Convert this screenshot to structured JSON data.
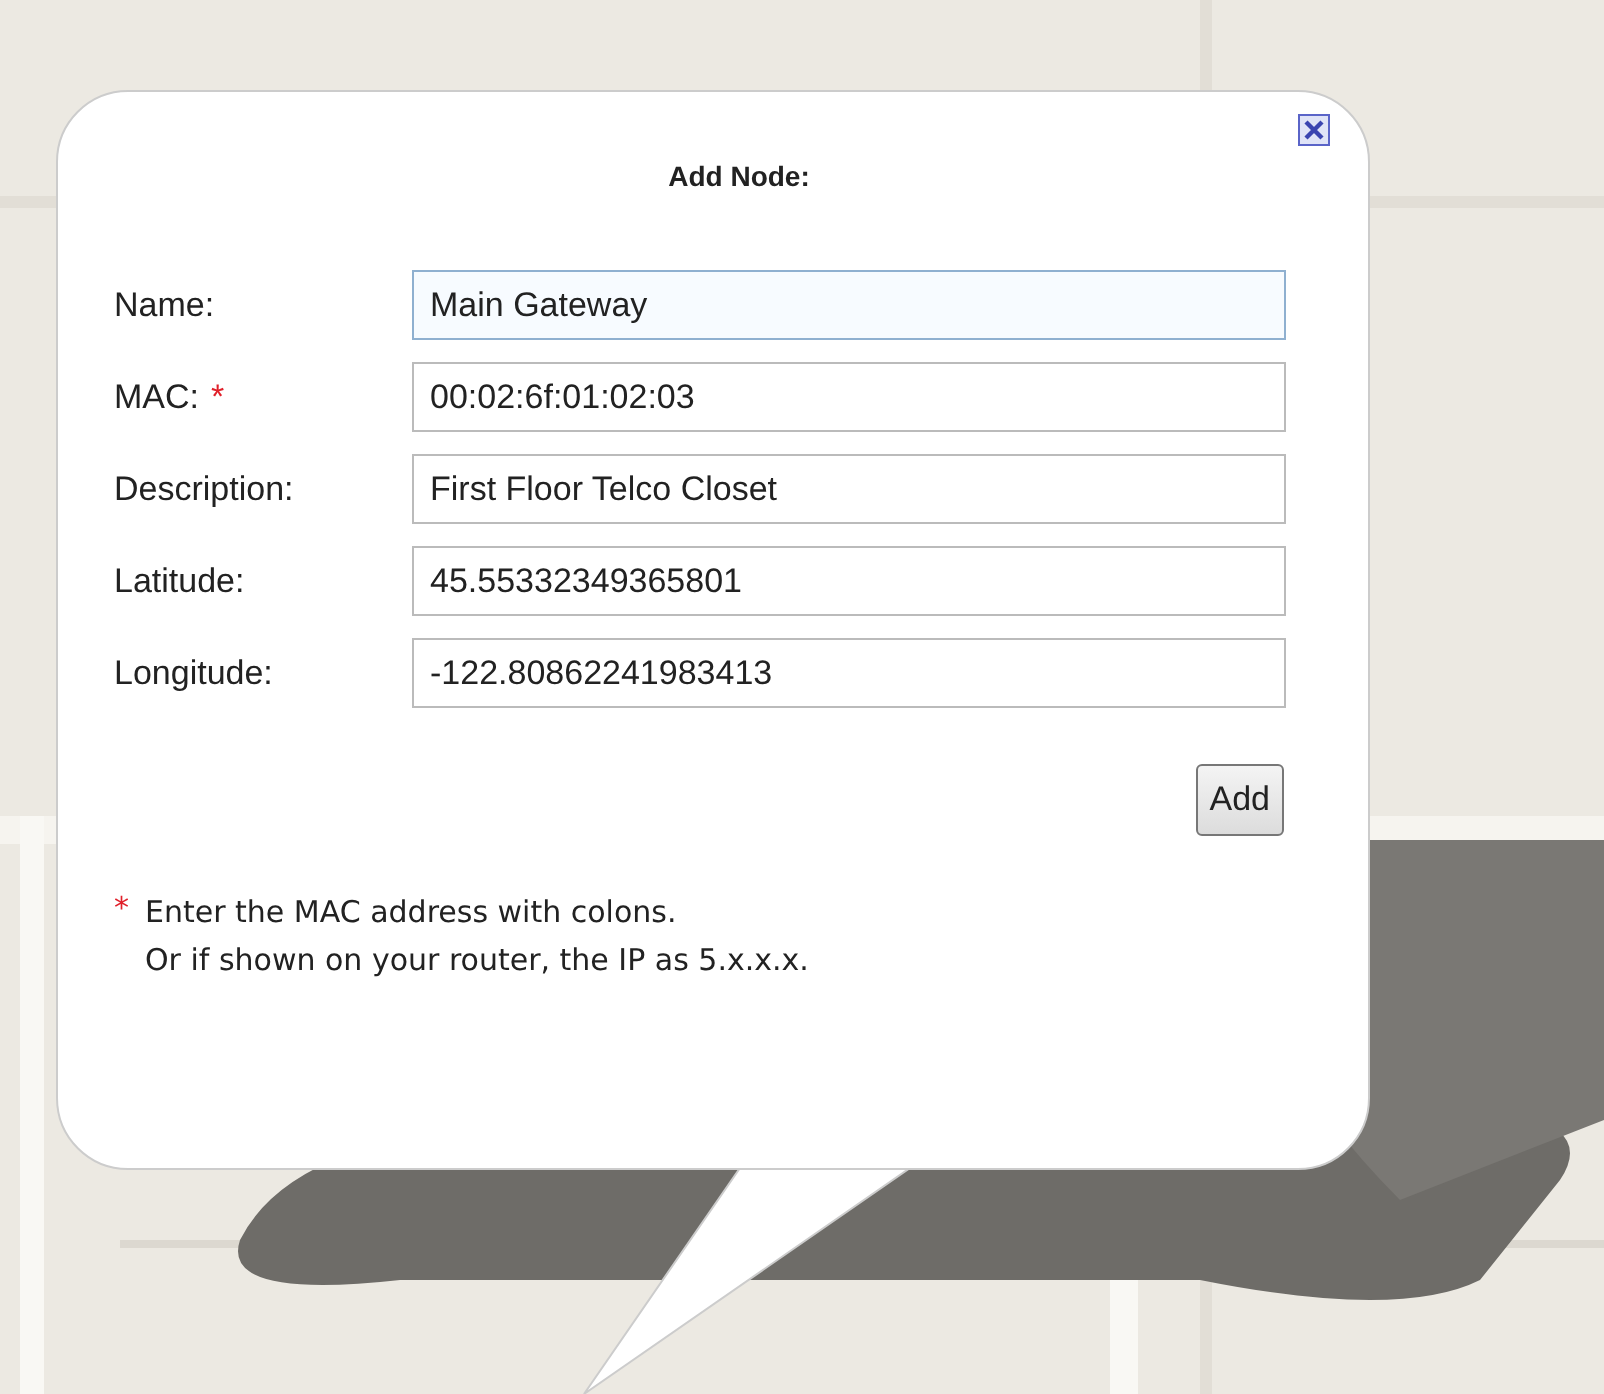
{
  "dialog": {
    "title": "Add Node:",
    "fields": [
      {
        "label": "Name:",
        "value": "Main Gateway",
        "focused": true
      },
      {
        "label": "MAC:",
        "marker": "*",
        "value": "00:02:6f:01:02:03",
        "focused": false
      },
      {
        "label": "Description:",
        "value": "First Floor Telco Closet",
        "focused": false
      },
      {
        "label": "Latitude:",
        "value": "45.55332349365801",
        "focused": false
      },
      {
        "label": "Longitude:",
        "value": "-122.80862241983413",
        "focused": false
      }
    ],
    "button": "Add",
    "note": {
      "marker": "*",
      "lines": [
        "Enter the MAC address with colons.",
        "Or if shown on your router, the IP as 5.x.x.x."
      ]
    }
  }
}
